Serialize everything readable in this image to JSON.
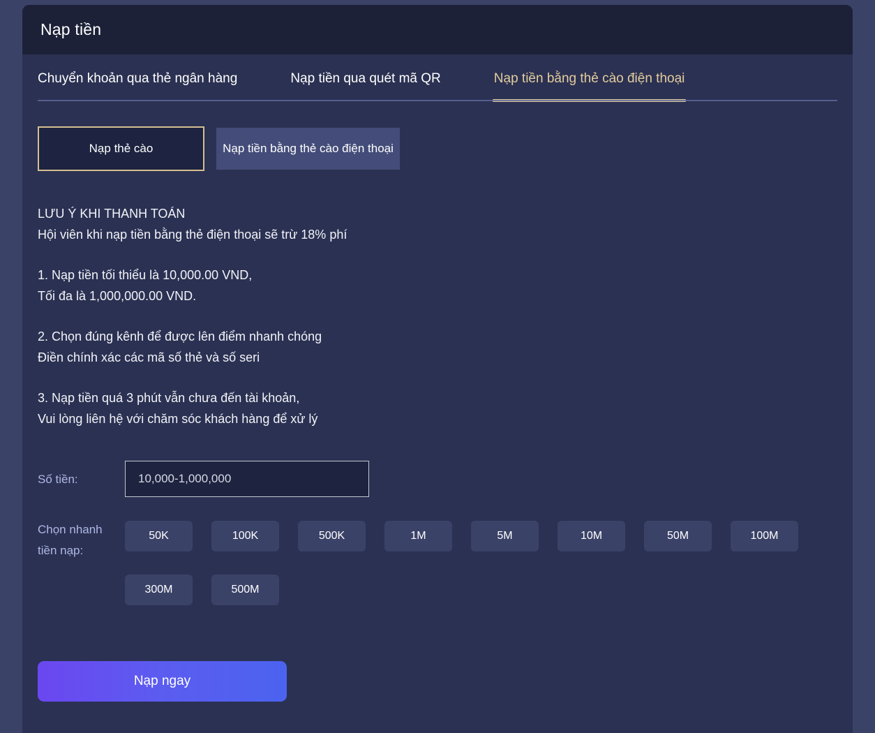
{
  "header": {
    "title": "Nạp tiền"
  },
  "tabs": [
    {
      "label": "Chuyển khoản qua thẻ ngân hàng",
      "active": false
    },
    {
      "label": "Nạp tiền qua quét mã QR",
      "active": false
    },
    {
      "label": "Nạp tiền bằng thẻ cào điện thoại",
      "active": true
    }
  ],
  "method_buttons": {
    "selected": "Nạp thẻ cào",
    "alternate": "Nạp tiền bằng thẻ cào điện thoại"
  },
  "notice": {
    "heading": "LƯU Ý KHI THANH TOÁN",
    "subheading": "Hội viên khi nạp tiền bằng thẻ điện thoại sẽ trừ 18% phí",
    "item1_line1": "1. Nạp tiền tối thiểu là 10,000.00 VND,",
    "item1_line2": "Tối đa là 1,000,000.00 VND.",
    "item2_line1": "2. Chọn đúng kênh để được lên điểm nhanh chóng",
    "item2_line2": "Điền chính xác các mã số thẻ và số seri",
    "item3_line1": "3. Nạp tiền quá 3 phút vẫn chưa đến tài khoản,",
    "item3_line2": "Vui lòng liên hệ với chăm sóc khách hàng để xử lý"
  },
  "amount": {
    "label": "Số tiền:",
    "placeholder": "10,000-1,000,000",
    "value": ""
  },
  "quick_select": {
    "label": "Chọn nhanh tiền nạp:",
    "options": [
      "50K",
      "100K",
      "500K",
      "1M",
      "5M",
      "10M",
      "50M",
      "100M",
      "300M",
      "500M"
    ]
  },
  "submit": {
    "label": "Nạp ngay"
  },
  "colors": {
    "page_background": "#3a4268",
    "card_background": "#2b3152",
    "header_background": "#1c2138",
    "accent_gold": "#dcc79b",
    "label_blue": "#aeb8e6",
    "chip_background": "#3b4268",
    "submit_gradient_start": "#6b47f0",
    "submit_gradient_end": "#4b63ef"
  }
}
